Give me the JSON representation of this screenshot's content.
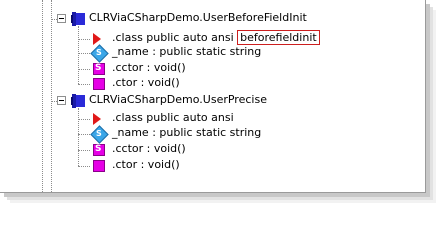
{
  "tree": {
    "nodes": [
      {
        "class_label": "CLRViaCSharpDemo.UserBeforeFieldInit",
        "children": [
          {
            "kind": "class-attr",
            "icon": "red-triangle-icon",
            "prefix": ".class public auto ansi ",
            "highlighted": "beforefieldinit"
          },
          {
            "kind": "static-field",
            "icon": "static-field-icon",
            "label": "_name : public static string"
          },
          {
            "kind": "static-method",
            "icon": "static-method-icon",
            "label": ".cctor : void()"
          },
          {
            "kind": "method",
            "icon": "method-icon",
            "label": ".ctor : void()"
          }
        ]
      },
      {
        "class_label": "CLRViaCSharpDemo.UserPrecise",
        "children": [
          {
            "kind": "class-attr",
            "icon": "red-triangle-icon",
            "label": ".class public auto ansi"
          },
          {
            "kind": "static-field",
            "icon": "static-field-icon",
            "label": "_name : public static string"
          },
          {
            "kind": "static-method",
            "icon": "static-method-icon",
            "label": ".cctor : void()"
          },
          {
            "kind": "method",
            "icon": "method-icon",
            "label": ".ctor : void()"
          }
        ]
      }
    ]
  },
  "colors": {
    "highlight_border": "#cc1e1e",
    "class_icon": "#2a2ad8",
    "triangle": "#e01818",
    "static_field": "#3aa6e8",
    "method": "#e600e6"
  }
}
